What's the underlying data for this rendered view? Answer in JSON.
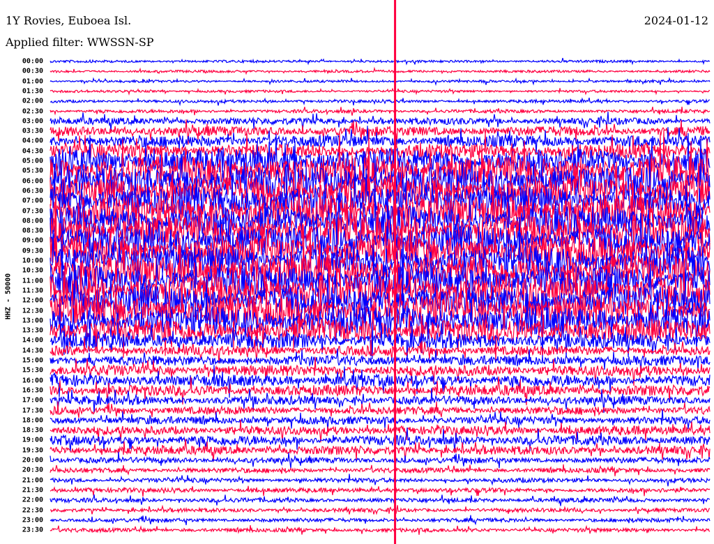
{
  "header": {
    "station": "1Y Rovies, Euboea Isl.",
    "filter": "Applied filter: WWSSN-SP",
    "date": "2024-01-12"
  },
  "chart_data": {
    "type": "helicorder",
    "ylabel": "HHZ - 50000",
    "row_minutes": 30,
    "colors": [
      "#0000ff",
      "#ff0040"
    ],
    "rows": [
      {
        "t": "00:00",
        "amp": 0.25
      },
      {
        "t": "00:30",
        "amp": 0.25
      },
      {
        "t": "01:00",
        "amp": 0.25
      },
      {
        "t": "01:30",
        "amp": 0.25
      },
      {
        "t": "02:00",
        "amp": 0.3
      },
      {
        "t": "02:30",
        "amp": 0.35
      },
      {
        "t": "03:00",
        "amp": 0.7
      },
      {
        "t": "03:30",
        "amp": 1.0
      },
      {
        "t": "04:00",
        "amp": 1.2
      },
      {
        "t": "04:30",
        "amp": 1.5
      },
      {
        "t": "05:00",
        "amp": 2.5
      },
      {
        "t": "05:30",
        "amp": 3
      },
      {
        "t": "06:00",
        "amp": 3
      },
      {
        "t": "06:30",
        "amp": 3
      },
      {
        "t": "07:00",
        "amp": 3
      },
      {
        "t": "07:30",
        "amp": 3
      },
      {
        "t": "08:00",
        "amp": 3
      },
      {
        "t": "08:30",
        "amp": 3
      },
      {
        "t": "09:00",
        "amp": 3
      },
      {
        "t": "09:30",
        "amp": 3
      },
      {
        "t": "10:00",
        "amp": 3
      },
      {
        "t": "10:30",
        "amp": 3
      },
      {
        "t": "11:00",
        "amp": 3
      },
      {
        "t": "11:30",
        "amp": 3
      },
      {
        "t": "12:00",
        "amp": 3
      },
      {
        "t": "12:30",
        "amp": 3
      },
      {
        "t": "13:00",
        "amp": 2.8
      },
      {
        "t": "13:30",
        "amp": 2.4
      },
      {
        "t": "14:00",
        "amp": 1.6
      },
      {
        "t": "14:30",
        "amp": 1.0
      },
      {
        "t": "15:00",
        "amp": 1.0
      },
      {
        "t": "15:30",
        "amp": 1.1
      },
      {
        "t": "16:00",
        "amp": 1.2
      },
      {
        "t": "16:30",
        "amp": 1.1
      },
      {
        "t": "17:00",
        "amp": 0.9
      },
      {
        "t": "17:30",
        "amp": 0.8
      },
      {
        "t": "18:00",
        "amp": 0.8
      },
      {
        "t": "18:30",
        "amp": 0.9
      },
      {
        "t": "19:00",
        "amp": 1.0
      },
      {
        "t": "19:30",
        "amp": 0.9
      },
      {
        "t": "20:00",
        "amp": 0.6
      },
      {
        "t": "20:30",
        "amp": 0.5
      },
      {
        "t": "21:00",
        "amp": 0.45
      },
      {
        "t": "21:30",
        "amp": 0.45
      },
      {
        "t": "22:00",
        "amp": 0.45
      },
      {
        "t": "22:30",
        "amp": 0.4
      },
      {
        "t": "23:00",
        "amp": 0.4
      },
      {
        "t": "23:30",
        "amp": 0.4
      }
    ],
    "spike_minute": 15.7
  }
}
